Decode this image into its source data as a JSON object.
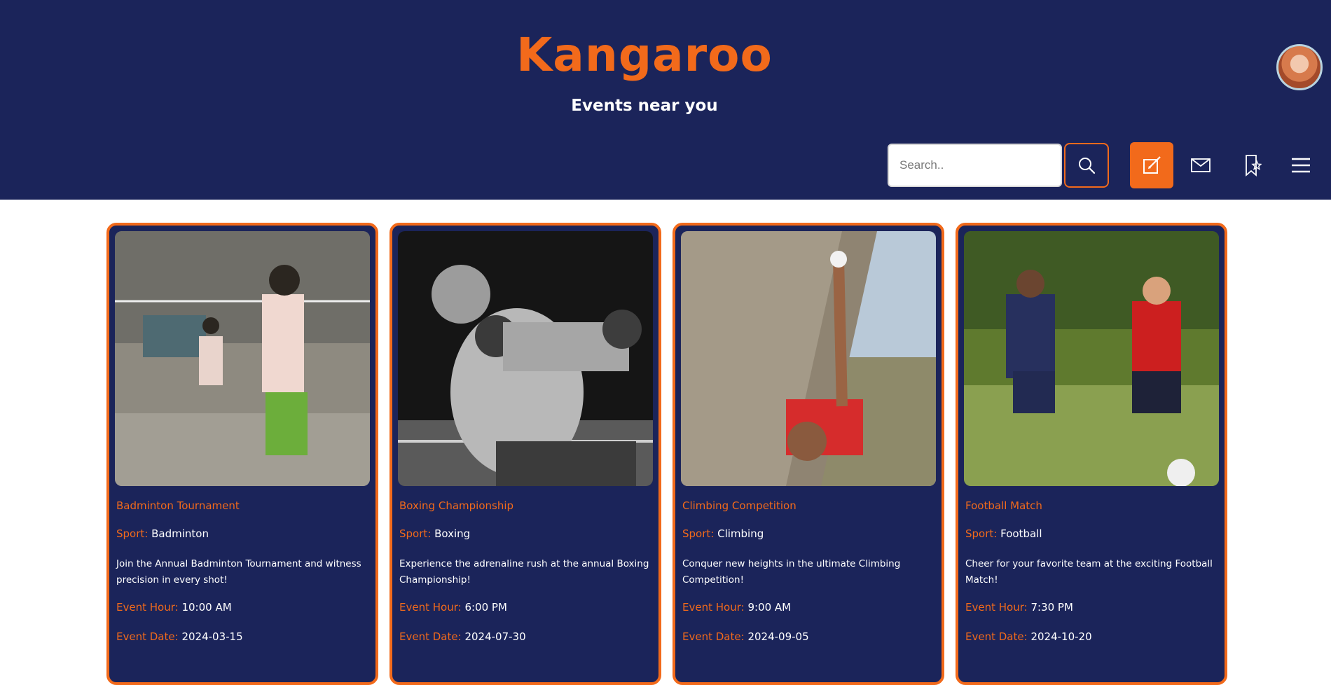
{
  "header": {
    "brand": "Kangaroo",
    "subtitle": "Events near you",
    "search_placeholder": "Search.."
  },
  "toolbar_icons": [
    "search-icon",
    "edit-icon",
    "mail-icon",
    "bookmark-star-icon",
    "menu-icon"
  ],
  "colors": {
    "primary": "#1b245a",
    "accent": "#f26a1b",
    "text": "#ffffff"
  },
  "labels": {
    "sport": "Sport:",
    "event_hour": "Event Hour:",
    "event_date": "Event Date:"
  },
  "events": [
    {
      "title": "Badminton Tournament",
      "sport": "Badminton",
      "description": "Join the Annual Badminton Tournament and witness precision in every shot!",
      "hour": "10:00 AM",
      "date": "2024-03-15"
    },
    {
      "title": "Boxing Championship",
      "sport": "Boxing",
      "description": "Experience the adrenaline rush at the annual Boxing Championship!",
      "hour": "6:00 PM",
      "date": "2024-07-30"
    },
    {
      "title": "Climbing Competition",
      "sport": "Climbing",
      "description": "Conquer new heights in the ultimate Climbing Competition!",
      "hour": "9:00 AM",
      "date": "2024-09-05"
    },
    {
      "title": "Football Match",
      "sport": "Football",
      "description": "Cheer for your favorite team at the exciting Football Match!",
      "hour": "7:30 PM",
      "date": "2024-10-20"
    }
  ]
}
